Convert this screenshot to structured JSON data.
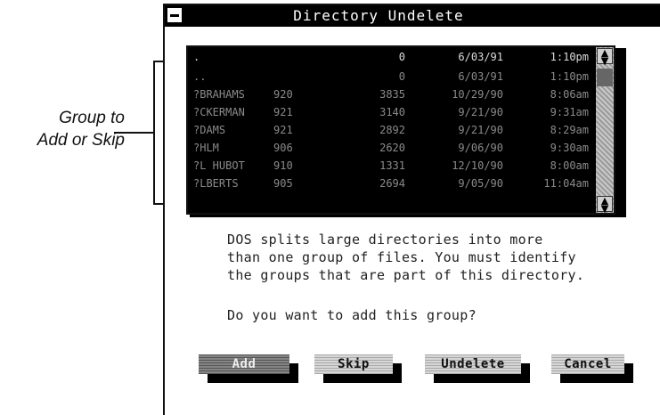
{
  "annotation": {
    "lines": [
      "Group to",
      "Add or Skip"
    ]
  },
  "window": {
    "title": "Directory Undelete"
  },
  "file_list": {
    "rows": [
      {
        "name": ".",
        "ext": "",
        "size": "0",
        "date": "6/03/91",
        "time": "1:10pm"
      },
      {
        "name": "..",
        "ext": "",
        "size": "0",
        "date": "6/03/91",
        "time": "1:10pm"
      },
      {
        "name": "?BRAHAMS",
        "ext": "920",
        "size": "3835",
        "date": "10/29/90",
        "time": "8:06am"
      },
      {
        "name": "?CKERMAN",
        "ext": "921",
        "size": "3140",
        "date": "9/21/90",
        "time": "9:31am"
      },
      {
        "name": "?DAMS",
        "ext": "921",
        "size": "2892",
        "date": "9/21/90",
        "time": "8:29am"
      },
      {
        "name": "?HLM",
        "ext": "906",
        "size": "2620",
        "date": "9/06/90",
        "time": "9:30am"
      },
      {
        "name": "?L HUBOT",
        "ext": "910",
        "size": "1331",
        "date": "12/10/90",
        "time": "8:00am"
      },
      {
        "name": "?LBERTS",
        "ext": "905",
        "size": "2694",
        "date": "9/05/90",
        "time": "11:04am"
      }
    ],
    "scroll_up_icon": "arrow-up-icon",
    "scroll_down_icon": "arrow-down-icon"
  },
  "message": {
    "line1": "DOS splits large directories into more",
    "line2": "than one group of files. You must identify",
    "line3": "the groups that are part of this directory.",
    "question": "Do you want to add this group?"
  },
  "buttons": {
    "add": "Add",
    "skip": "Skip",
    "undelete": "Undelete",
    "cancel": "Cancel"
  }
}
